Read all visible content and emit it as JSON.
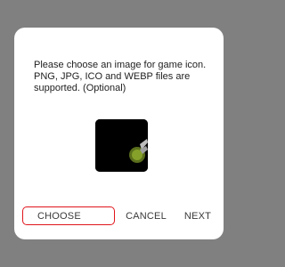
{
  "dialog": {
    "message": "Please choose an image for game icon. PNG, JPG, ICO and WEBP files are supported. (Optional)",
    "preview": {
      "icon": "game-icon-preview"
    },
    "buttons": {
      "choose": "CHOOSE",
      "cancel": "CANCEL",
      "next": "NEXT"
    }
  },
  "colors": {
    "backdrop": "#808080",
    "highlight": "#e0151b"
  }
}
